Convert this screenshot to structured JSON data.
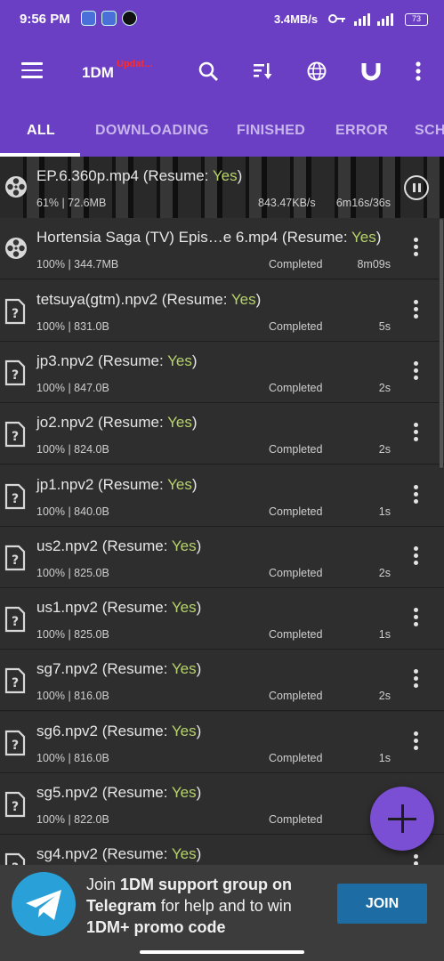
{
  "status_bar": {
    "time": "9:56 PM",
    "network_speed": "3.4MB/s",
    "network_type": "4G",
    "battery": "73"
  },
  "app_bar": {
    "title": "1DM",
    "update_badge": "Updat...",
    "icons": [
      "menu-icon",
      "search-icon",
      "sort-icon",
      "browser-icon",
      "magnet-icon",
      "more-icon"
    ],
    "accent_color": "#6b3fc4"
  },
  "tabs": [
    {
      "label": "ALL",
      "active": true
    },
    {
      "label": "DOWNLOADING",
      "active": false
    },
    {
      "label": "FINISHED",
      "active": false
    },
    {
      "label": "ERROR",
      "active": false
    },
    {
      "label": "SCH",
      "active": false
    }
  ],
  "downloads": [
    {
      "icon": "video-reel-icon",
      "name": "EP.6.360p.mp4",
      "resume_label": "(Resume: ",
      "resume_value": "Yes",
      "resume_close": ")",
      "meta": "61% | 72.6MB",
      "status": "843.47KB/s",
      "time": "6m16s/36s",
      "active": true
    },
    {
      "icon": "video-reel-icon",
      "name": "Hortensia Saga (TV) Epis…e 6.mp4",
      "resume_label": "(Resume: ",
      "resume_value": "Yes",
      "resume_close": ")",
      "meta": "100% | 344.7MB",
      "status": "Completed",
      "time": "8m09s"
    },
    {
      "icon": "unknown-file-icon",
      "name": "tetsuya(gtm).npv2",
      "resume_label": "(Resume: ",
      "resume_value": "Yes",
      "resume_close": ")",
      "meta": "100% | 831.0B",
      "status": "Completed",
      "time": "5s"
    },
    {
      "icon": "unknown-file-icon",
      "name": "jp3.npv2",
      "resume_label": "(Resume: ",
      "resume_value": "Yes",
      "resume_close": ")",
      "meta": "100% | 847.0B",
      "status": "Completed",
      "time": "2s"
    },
    {
      "icon": "unknown-file-icon",
      "name": "jo2.npv2",
      "resume_label": "(Resume: ",
      "resume_value": "Yes",
      "resume_close": ")",
      "meta": "100% | 824.0B",
      "status": "Completed",
      "time": "2s"
    },
    {
      "icon": "unknown-file-icon",
      "name": "jp1.npv2",
      "resume_label": "(Resume: ",
      "resume_value": "Yes",
      "resume_close": ")",
      "meta": "100% | 840.0B",
      "status": "Completed",
      "time": "1s"
    },
    {
      "icon": "unknown-file-icon",
      "name": "us2.npv2",
      "resume_label": "(Resume: ",
      "resume_value": "Yes",
      "resume_close": ")",
      "meta": "100% | 825.0B",
      "status": "Completed",
      "time": "2s"
    },
    {
      "icon": "unknown-file-icon",
      "name": "us1.npv2",
      "resume_label": "(Resume: ",
      "resume_value": "Yes",
      "resume_close": ")",
      "meta": "100% | 825.0B",
      "status": "Completed",
      "time": "1s"
    },
    {
      "icon": "unknown-file-icon",
      "name": "sg7.npv2",
      "resume_label": "(Resume: ",
      "resume_value": "Yes",
      "resume_close": ")",
      "meta": "100% | 816.0B",
      "status": "Completed",
      "time": "2s"
    },
    {
      "icon": "unknown-file-icon",
      "name": "sg6.npv2",
      "resume_label": "(Resume: ",
      "resume_value": "Yes",
      "resume_close": ")",
      "meta": "100% | 816.0B",
      "status": "Completed",
      "time": "1s"
    },
    {
      "icon": "unknown-file-icon",
      "name": "sg5.npv2",
      "resume_label": "(Resume: ",
      "resume_value": "Yes",
      "resume_close": ")",
      "meta": "100% | 822.0B",
      "status": "Completed",
      "time": ""
    },
    {
      "icon": "unknown-file-icon",
      "name": "sg4.npv2",
      "resume_label": "(Resume: ",
      "resume_value": "Yes",
      "resume_close": ")",
      "meta": "",
      "status": "",
      "time": ""
    }
  ],
  "banner": {
    "line1_pre": "Join ",
    "line1_bold": "1DM support group on",
    "line2_bold": "Telegram",
    "line2_rest": " for help and to win",
    "line3_bold": "1DM+ promo code",
    "join_label": "JOIN"
  }
}
